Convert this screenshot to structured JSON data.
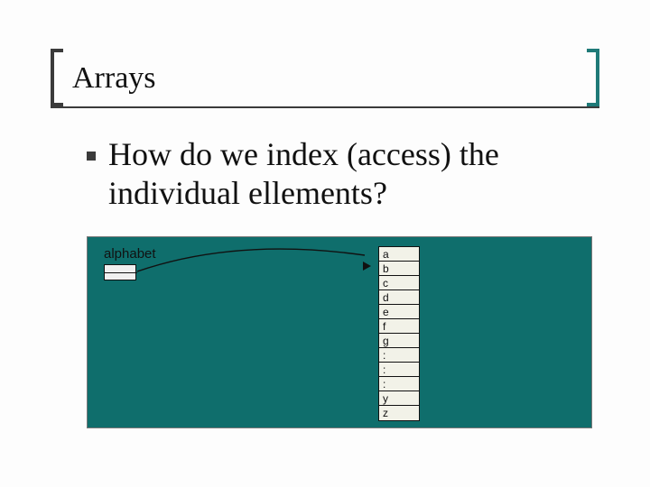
{
  "title": "Arrays",
  "bullet": "How do we index (access) the individual ellements?",
  "diagram": {
    "ref_label": "alphabet",
    "cells": [
      "a",
      "b",
      "c",
      "d",
      "e",
      "f",
      "g",
      ":",
      ":",
      ":",
      "y",
      "z"
    ]
  }
}
